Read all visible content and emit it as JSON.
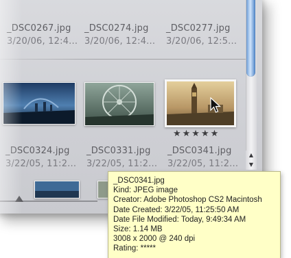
{
  "grid": {
    "row1": [
      {
        "name": "_DSC0267.jpg",
        "date": "3/20/06, 12:4..."
      },
      {
        "name": "_DSC0274.jpg",
        "date": "3/20/06, 12:4..."
      },
      {
        "name": "_DSC0277.jpg",
        "date": "3/20/06, 12:5..."
      }
    ],
    "row2": [
      {
        "name": "_DSC0324.jpg",
        "date": "3/22/05, 11:2..."
      },
      {
        "name": "_DSC0331.jpg",
        "date": "3/22/05, 11:2..."
      },
      {
        "name": "_DSC0341.jpg",
        "date": "3/22/05, 11:2...",
        "rating": "★★★★★"
      }
    ]
  },
  "tooltip": {
    "filename": "_DSC0341.jpg",
    "kind": "Kind: JPEG image",
    "creator": "Creator: Adobe Photoshop CS2 Macintosh",
    "date_created": "Date Created: 3/22/05, 11:25:50 AM",
    "date_modified": "Date File Modified: Today, 9:49:34 AM",
    "size": "Size: 1.14 MB",
    "dimensions": "3008 x 2000 @ 240 dpi",
    "rating": "Rating: *****"
  },
  "scrollbar": {
    "up_arrow": "▲",
    "down_arrow": "▼"
  },
  "colors": {
    "panel": "#d2d3d8",
    "scroll_thumb": "#6f9fd8",
    "tooltip_bg": "#ffffc7"
  }
}
